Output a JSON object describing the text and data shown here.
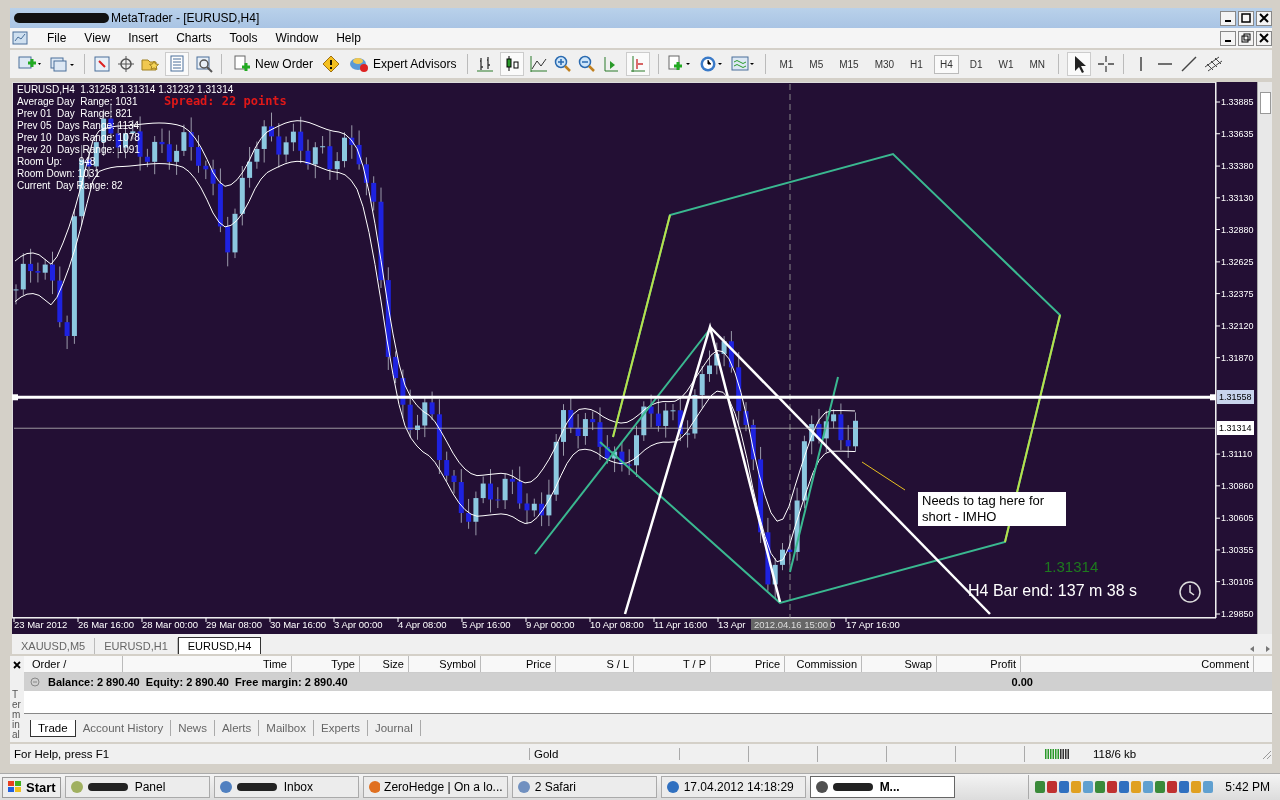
{
  "window": {
    "title": "MetaTrader - [EURUSD,H4]",
    "title_redacted": true
  },
  "menu": [
    "File",
    "View",
    "Insert",
    "Charts",
    "Tools",
    "Window",
    "Help"
  ],
  "toolbar": {
    "buttons": [
      {
        "label": "New Order"
      },
      {
        "label": "Expert Advisors"
      }
    ],
    "timeframes": [
      {
        "label": "M1",
        "selected": false
      },
      {
        "label": "M5",
        "selected": false
      },
      {
        "label": "M15",
        "selected": false
      },
      {
        "label": "M30",
        "selected": false
      },
      {
        "label": "H1",
        "selected": false
      },
      {
        "label": "H4",
        "selected": true
      },
      {
        "label": "D1",
        "selected": false
      },
      {
        "label": "W1",
        "selected": false
      },
      {
        "label": "MN",
        "selected": false
      }
    ]
  },
  "chart": {
    "info_line": "EURUSD,H4  1.31258 1.31314 1.31232 1.31314",
    "indicator_lines": [
      "Average Day  Range: 1031",
      "Prev 01  Day  Range: 821",
      "Prev 05  Days Range: 1134",
      "Prev 10  Days Range: 1078",
      "Prev 20  Days Range: 1091",
      "Room Up:      948",
      "Room Down: 1031",
      "Current  Day Range: 82"
    ],
    "spread": "Spread: 22 points",
    "price_labels": [
      "1.33885",
      "1.33635",
      "1.33380",
      "1.33130",
      "1.32880",
      "1.32625",
      "1.32375",
      "1.32120",
      "1.31870",
      "1.31110",
      "1.30860",
      "1.30605",
      "1.30355",
      "1.30105",
      "1.29850"
    ],
    "marked_prices": [
      {
        "label": "1.31558",
        "kind": "line"
      },
      {
        "label": "1.31314",
        "kind": "bid"
      }
    ],
    "time_labels": [
      "23 Mar 2012",
      "26 Mar 16:00",
      "28 Mar 00:00",
      "29 Mar 08:00",
      "30 Mar 16:00",
      "3 Apr 00:00",
      "4 Apr 08:00",
      "5 Apr 16:00",
      "9 Apr 00:00",
      "10 Apr 08:00",
      "11 Apr 16:00",
      "13 Apr",
      "17 Apr 16:00"
    ],
    "crosshair_time": "2012.04.16 15:00",
    "time_fragment": "0",
    "note": "Needs to tag here for short - IMHO",
    "bid": "1.31314",
    "bar_end": "H4 Bar end: 137 m 38 s"
  },
  "chart_tabs": [
    {
      "label": "XAUUSD,M5",
      "selected": false
    },
    {
      "label": "EURUSD,H1",
      "selected": false
    },
    {
      "label": "EURUSD,H4",
      "selected": true
    }
  ],
  "terminal": {
    "title": "Terminal",
    "columns": [
      "Order /",
      "Time",
      "Type",
      "Size",
      "Symbol",
      "Price",
      "S / L",
      "T / P",
      "Price",
      "Commission",
      "Swap",
      "Profit",
      "Comment"
    ],
    "balance": "Balance: 2 890.40  Equity: 2 890.40  Free margin: 2 890.40",
    "profit": "0.00",
    "tabs": [
      {
        "label": "Trade",
        "selected": true
      },
      {
        "label": "Account History",
        "selected": false
      },
      {
        "label": "News",
        "selected": false
      },
      {
        "label": "Alerts",
        "selected": false
      },
      {
        "label": "Mailbox",
        "selected": false
      },
      {
        "label": "Experts",
        "selected": false
      },
      {
        "label": "Journal",
        "selected": false
      }
    ]
  },
  "status_bar": {
    "help": "For Help, press F1",
    "profile": "Gold",
    "traffic": "118/6 kb"
  },
  "taskbar": {
    "start": "Start",
    "items": [
      {
        "label": "Panel",
        "redacted": true,
        "selected": false
      },
      {
        "label": "Inbox",
        "redacted": true,
        "selected": false
      },
      {
        "label": "ZeroHedge | On a lo...",
        "redacted": false,
        "selected": false
      },
      {
        "label": "2 Safari",
        "redacted": false,
        "selected": false
      },
      {
        "label": "17.04.2012  14:18:29",
        "redacted": false,
        "selected": false
      },
      {
        "label": "M...",
        "redacted": true,
        "selected": true
      }
    ],
    "clock": "5:42 PM"
  }
}
